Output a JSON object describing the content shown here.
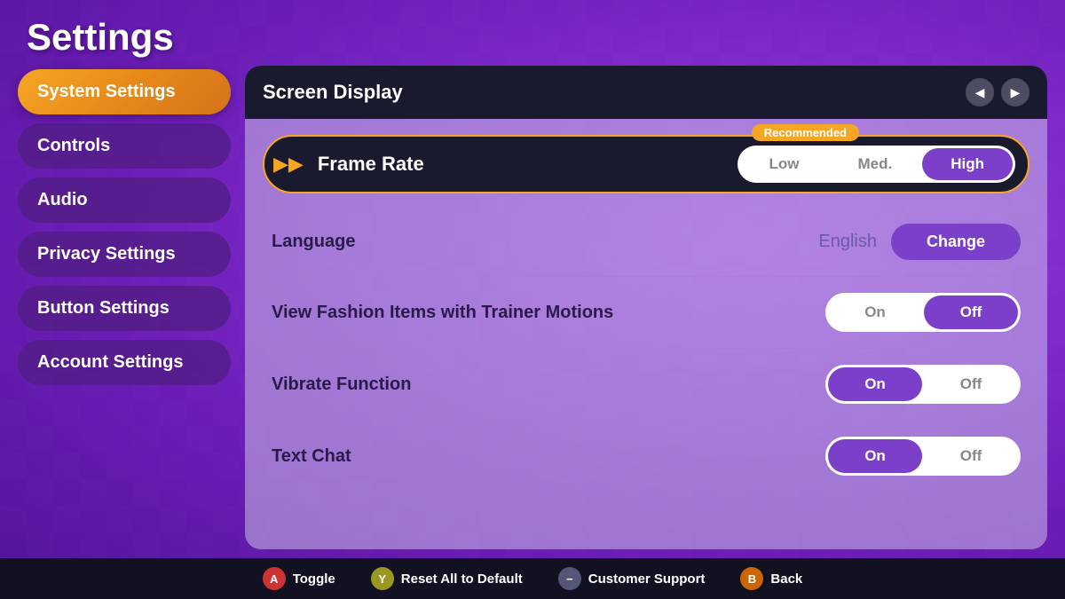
{
  "page": {
    "title": "Settings"
  },
  "sidebar": {
    "items": [
      {
        "id": "system-settings",
        "label": "System Settings",
        "active": true
      },
      {
        "id": "controls",
        "label": "Controls",
        "active": false
      },
      {
        "id": "audio",
        "label": "Audio",
        "active": false
      },
      {
        "id": "privacy-settings",
        "label": "Privacy Settings",
        "active": false
      },
      {
        "id": "button-settings",
        "label": "Button Settings",
        "active": false
      },
      {
        "id": "account-settings",
        "label": "Account Settings",
        "active": false
      }
    ]
  },
  "panel": {
    "header": "Screen Display",
    "recommended_badge": "Recommended",
    "frame_rate": {
      "label": "Frame Rate",
      "options": [
        "Low",
        "Med.",
        "High"
      ],
      "selected": "High"
    },
    "language": {
      "label": "Language",
      "value": "English",
      "button": "Change"
    },
    "fashion_items": {
      "label": "View Fashion Items with Trainer Motions",
      "options": [
        "On",
        "Off"
      ],
      "selected": "Off"
    },
    "vibrate": {
      "label": "Vibrate Function",
      "options": [
        "On",
        "Off"
      ],
      "selected": "On"
    },
    "text_chat": {
      "label": "Text Chat",
      "options": [
        "On",
        "Off"
      ],
      "selected": "On"
    }
  },
  "bottom_bar": {
    "actions": [
      {
        "id": "toggle",
        "button": "Ⓐ",
        "label": "Toggle",
        "btn_class": "btn-a"
      },
      {
        "id": "reset",
        "button": "Ⓨ",
        "label": "Reset All to Default",
        "btn_class": "btn-y"
      },
      {
        "id": "support",
        "button": "−",
        "label": "Customer Support",
        "btn_class": "btn-minus"
      },
      {
        "id": "back",
        "button": "Ⓑ",
        "label": "Back",
        "btn_class": "btn-b"
      }
    ]
  }
}
